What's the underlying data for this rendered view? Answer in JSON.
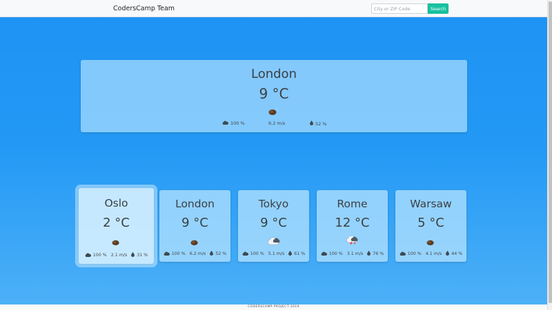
{
  "navbar": {
    "brand": "CodersCamp Team",
    "search_placeholder": "City or ZIP Code",
    "search_button": "Search"
  },
  "current": {
    "city": "London",
    "temperature": "9 °C",
    "icon": "shower-rain-icon",
    "clouds": "100 %",
    "wind": "6.2 m/s",
    "humidity": "52 %"
  },
  "cities": [
    {
      "city": "Oslo",
      "temperature": "2 °C",
      "icon": "shower-rain-icon",
      "clouds": "100 %",
      "wind": "2.1 m/s",
      "humidity": "31 %",
      "active": true
    },
    {
      "city": "London",
      "temperature": "9 °C",
      "icon": "shower-rain-icon",
      "clouds": "100 %",
      "wind": "6.2 m/s",
      "humidity": "52 %",
      "active": false
    },
    {
      "city": "Tokyo",
      "temperature": "9 °C",
      "icon": "cloudy-icon",
      "clouds": "100 %",
      "wind": "5.1 m/s",
      "humidity": "61 %",
      "active": false
    },
    {
      "city": "Rome",
      "temperature": "12 °C",
      "icon": "thunderstorm-icon",
      "clouds": "100 %",
      "wind": "3.1 m/s",
      "humidity": "76 %",
      "active": false
    },
    {
      "city": "Warsaw",
      "temperature": "5 °C",
      "icon": "shower-rain-icon",
      "clouds": "100 %",
      "wind": "4.1 m/s",
      "humidity": "44 %",
      "active": false
    }
  ],
  "footer": {
    "text": "CODERSCAMP PROJECT 2019"
  },
  "colors": {
    "accent": "#18c2a0",
    "background_top": "#1f93f4",
    "background_bottom": "#4cb0f7"
  }
}
